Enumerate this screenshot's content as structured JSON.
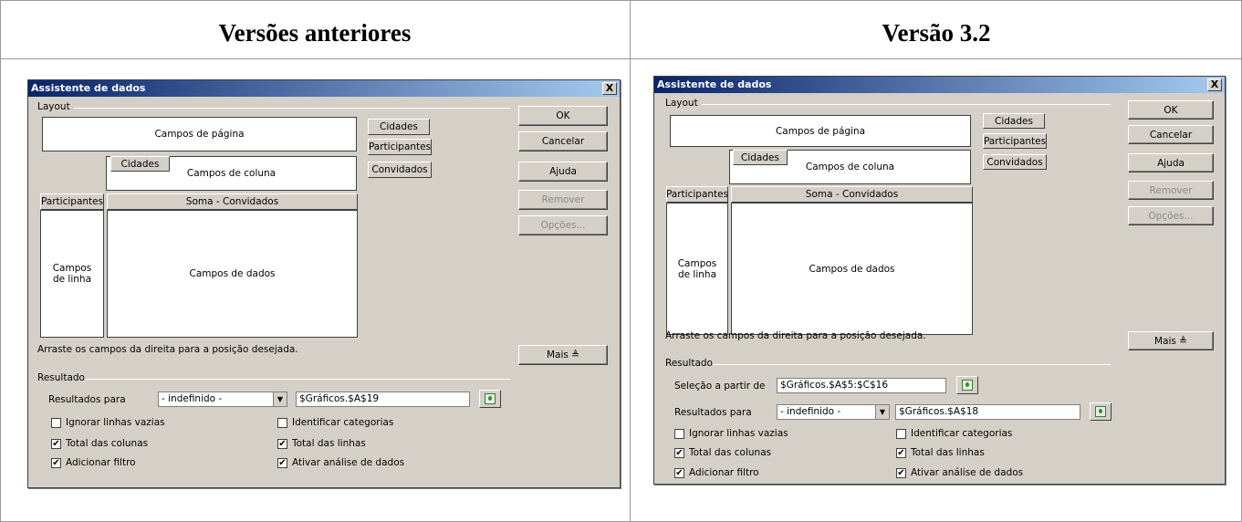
{
  "columns": {
    "left_title": "Versões anteriores",
    "right_title": "Versão 3.2"
  },
  "dialog": {
    "title": "Assistente de dados",
    "close": "X",
    "layout_label": "Layout",
    "page_fields": "Campos de página",
    "column_fields": "Campos de coluna",
    "column_field_button": "Cidades",
    "row_field_button": "Participantes",
    "data_field_button": "Soma - Convidados",
    "row_fields_line1": "Campos",
    "row_fields_line2": "de linha",
    "data_fields": "Campos de dados",
    "available_fields": [
      "Cidades",
      "Participantes",
      "Convidados"
    ],
    "hint": "Arraste os campos da direita para a posição desejada.",
    "buttons": {
      "ok": "OK",
      "cancel": "Cancelar",
      "help": "Ajuda",
      "remove": "Remover",
      "options": "Opções...",
      "more": "Mais ≜"
    },
    "result_label": "Resultado",
    "selection_from_label": "Seleção a partir de",
    "selection_from_value": "$Gráficos.$A$5:$C$16",
    "results_to_label": "Resultados para",
    "results_to_option": "- indefinido -",
    "old_results_target": "$Gráficos.$A$19",
    "new_results_target": "$Gráficos.$A$18",
    "checkboxes": {
      "ignore_empty": {
        "label": "Ignorar linhas vazias",
        "checked": false
      },
      "identify_categories": {
        "label": "Identificar categorias",
        "checked": false
      },
      "total_columns": {
        "label": "Total das colunas",
        "checked": true
      },
      "total_rows": {
        "label": "Total das linhas",
        "checked": true
      },
      "add_filter": {
        "label": "Adicionar filtro",
        "checked": true
      },
      "enable_drill": {
        "label": "Ativar análise de dados",
        "checked": true
      }
    },
    "check_mark": "✔"
  }
}
